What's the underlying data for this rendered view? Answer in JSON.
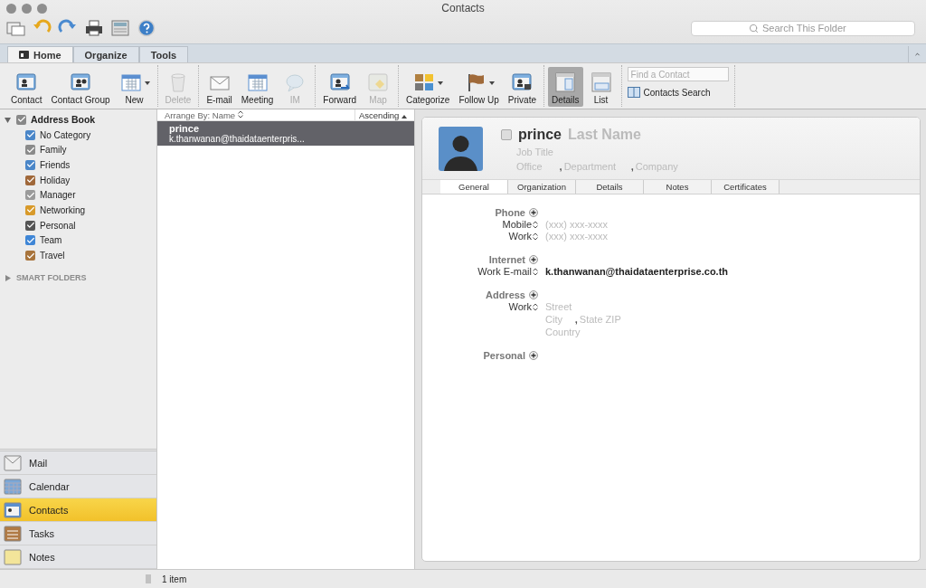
{
  "window": {
    "title": "Contacts"
  },
  "search": {
    "placeholder": "Search This Folder"
  },
  "ribbon_tabs": [
    {
      "label": "Home",
      "selected": true
    },
    {
      "label": "Organize",
      "selected": false
    },
    {
      "label": "Tools",
      "selected": false
    }
  ],
  "ribbon_groups": [
    {
      "buttons": [
        {
          "label": "Contact",
          "kind": "contact",
          "disabled": false,
          "dropdown": false,
          "selected": false
        },
        {
          "label": "Contact Group",
          "kind": "group",
          "disabled": false,
          "dropdown": false,
          "selected": false
        },
        {
          "label": "New",
          "kind": "new",
          "disabled": false,
          "dropdown": true,
          "selected": false
        }
      ]
    },
    {
      "buttons": [
        {
          "label": "Delete",
          "kind": "delete",
          "disabled": true,
          "dropdown": false,
          "selected": false
        }
      ]
    },
    {
      "buttons": [
        {
          "label": "E-mail",
          "kind": "mail",
          "disabled": false,
          "dropdown": false,
          "selected": false
        },
        {
          "label": "Meeting",
          "kind": "meeting",
          "disabled": false,
          "dropdown": false,
          "selected": false
        },
        {
          "label": "IM",
          "kind": "im",
          "disabled": true,
          "dropdown": false,
          "selected": false
        }
      ]
    },
    {
      "buttons": [
        {
          "label": "Forward",
          "kind": "forward",
          "disabled": false,
          "dropdown": false,
          "selected": false
        },
        {
          "label": "Map",
          "kind": "map",
          "disabled": true,
          "dropdown": false,
          "selected": false
        }
      ]
    },
    {
      "buttons": [
        {
          "label": "Categorize",
          "kind": "categorize",
          "disabled": false,
          "dropdown": true,
          "selected": false
        },
        {
          "label": "Follow Up",
          "kind": "flag",
          "disabled": false,
          "dropdown": true,
          "selected": false
        },
        {
          "label": "Private",
          "kind": "private",
          "disabled": false,
          "dropdown": false,
          "selected": false
        }
      ]
    },
    {
      "buttons": [
        {
          "label": "Details",
          "kind": "details",
          "disabled": false,
          "dropdown": false,
          "selected": true
        },
        {
          "label": "List",
          "kind": "list",
          "disabled": false,
          "dropdown": false,
          "selected": false
        }
      ]
    }
  ],
  "find_contact": {
    "placeholder": "Find a Contact"
  },
  "contacts_search": "Contacts Search",
  "address_book": {
    "label": "Address Book",
    "checked": true,
    "expanded": true,
    "categories": [
      {
        "label": "No Category",
        "checked": true,
        "color": "#4a86c8"
      },
      {
        "label": "Family",
        "checked": true,
        "color": "#8a8a8a"
      },
      {
        "label": "Friends",
        "checked": true,
        "color": "#4a86c8"
      },
      {
        "label": "Holiday",
        "checked": true,
        "color": "#a0683a"
      },
      {
        "label": "Manager",
        "checked": true,
        "color": "#9a9a9a"
      },
      {
        "label": "Networking",
        "checked": true,
        "color": "#d89a2a"
      },
      {
        "label": "Personal",
        "checked": true,
        "color": "#555555"
      },
      {
        "label": "Team",
        "checked": true,
        "color": "#3f86d6"
      },
      {
        "label": "Travel",
        "checked": true,
        "color": "#a8743c"
      }
    ]
  },
  "smart_folders": {
    "label": "SMART FOLDERS",
    "expanded": false
  },
  "nav": [
    {
      "label": "Mail",
      "kind": "mail",
      "selected": false
    },
    {
      "label": "Calendar",
      "kind": "calendar",
      "selected": false
    },
    {
      "label": "Contacts",
      "kind": "contacts",
      "selected": true
    },
    {
      "label": "Tasks",
      "kind": "tasks",
      "selected": false
    },
    {
      "label": "Notes",
      "kind": "notes",
      "selected": false
    }
  ],
  "list": {
    "arrange_by": "Arrange By: Name",
    "order": "Ascending",
    "rows": [
      {
        "name": "prince",
        "email": "k.thanwanan@thaidataenterpris...",
        "selected": true
      }
    ]
  },
  "status_bar": "1 item",
  "detail": {
    "flagged": false,
    "first_name": "prince",
    "last_name_placeholder": "Last Name",
    "job_title_placeholder": "Job Title",
    "company_line": [
      {
        "placeholder": "Office"
      },
      {
        "placeholder": "Department"
      },
      {
        "placeholder": "Company"
      }
    ],
    "separator": ",",
    "tabs": [
      {
        "label": "General",
        "selected": true
      },
      {
        "label": "Organization",
        "selected": false
      },
      {
        "label": "Details",
        "selected": false
      },
      {
        "label": "Notes",
        "selected": false
      },
      {
        "label": "Certificates",
        "selected": false
      }
    ],
    "sections": [
      {
        "heading": "Phone",
        "fields": [
          {
            "label": "Mobile",
            "lines": [
              [
                {
                  "placeholder": "(xxx) xxx-xxxx"
                }
              ]
            ]
          },
          {
            "label": "Work",
            "lines": [
              [
                {
                  "placeholder": "(xxx) xxx-xxxx"
                }
              ]
            ]
          }
        ]
      },
      {
        "heading": "Internet",
        "fields": [
          {
            "label": "Work E-mail",
            "value": "k.thanwanan@thaidataenterprise.co.th"
          }
        ]
      },
      {
        "heading": "Address",
        "fields": [
          {
            "label": "Work",
            "lines": [
              [
                {
                  "placeholder": "Street"
                }
              ],
              [
                {
                  "placeholder": "City"
                },
                {
                  "placeholder": "State ZIP"
                }
              ],
              [
                {
                  "placeholder": "Country"
                }
              ]
            ]
          }
        ]
      },
      {
        "heading": "Personal"
      }
    ]
  }
}
